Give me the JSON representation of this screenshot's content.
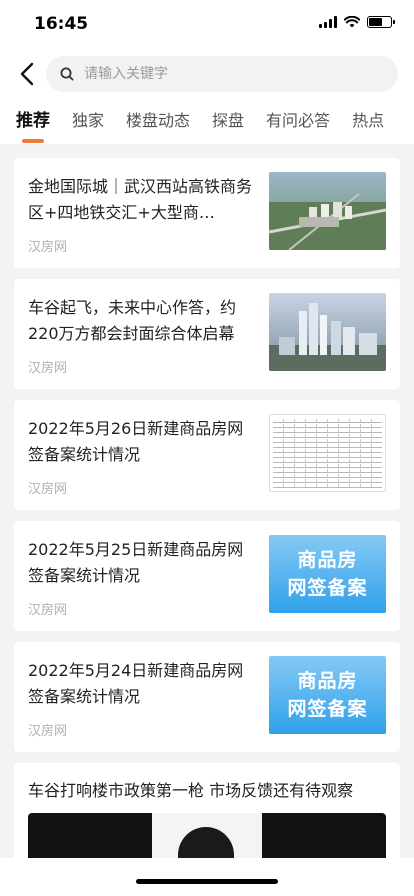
{
  "status_bar": {
    "time": "16:45"
  },
  "search": {
    "placeholder": "请输入关键字"
  },
  "tabs": [
    {
      "label": "推荐",
      "active": true
    },
    {
      "label": "独家"
    },
    {
      "label": "楼盘动态"
    },
    {
      "label": "探盘"
    },
    {
      "label": "有问必答"
    },
    {
      "label": "热点"
    }
  ],
  "feed": [
    {
      "title": "金地国际城｜武汉西站高铁商务区+四地铁交汇+大型商…",
      "source": "汉房网",
      "thumb": "aerial-photo"
    },
    {
      "title": "车谷起飞，未来中心作答，约220万方都会封面综合体启幕",
      "source": "汉房网",
      "thumb": "aerial-photo"
    },
    {
      "title": "2022年5月26日新建商品房网签备案统计情况",
      "source": "汉房网",
      "thumb": "table-image"
    },
    {
      "title": "2022年5月25日新建商品房网签备案统计情况",
      "source": "汉房网",
      "thumb_text": [
        "商品房",
        "网签备案"
      ]
    },
    {
      "title": "2022年5月24日新建商品房网签备案统计情况",
      "source": "汉房网",
      "thumb_text": [
        "商品房",
        "网签备案"
      ]
    }
  ],
  "video_card": {
    "title": "车谷打响楼市政策第一枪 市场反馈还有待观察"
  },
  "colors": {
    "accent": "#f47a3c",
    "badge": "#2fa1ea"
  }
}
